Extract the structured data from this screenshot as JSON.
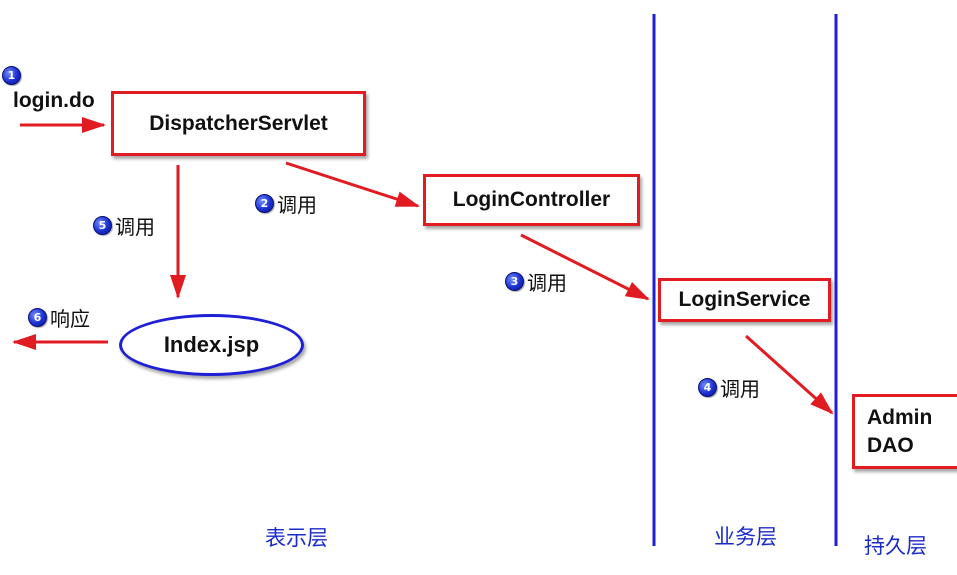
{
  "request": {
    "badge": "1",
    "text": "login.do"
  },
  "nodes": {
    "dispatcher": "DispatcherServlet",
    "controller": "LoginController",
    "service": "LoginService",
    "dao_line1": "Admin",
    "dao_line2": "DAO",
    "view": "Index.jsp"
  },
  "steps": [
    {
      "badge": "2",
      "text": "调用"
    },
    {
      "badge": "3",
      "text": "调用"
    },
    {
      "badge": "4",
      "text": "调用"
    },
    {
      "badge": "5",
      "text": "调用"
    },
    {
      "badge": "6",
      "text": "响应"
    }
  ],
  "layers": {
    "presentation": "表示层",
    "business": "业务层",
    "persistence": "持久层"
  },
  "colors": {
    "arrow": "#e01b22",
    "box_border": "#e01b22",
    "layer_line": "#1f1fd6",
    "layer_text": "#1b2bc8"
  }
}
